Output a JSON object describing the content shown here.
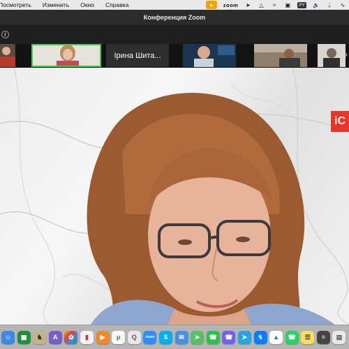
{
  "menubar": {
    "items": [
      "Посмотреть",
      "Изменить",
      "Окно",
      "Справка"
    ],
    "status": {
      "app_indicator": "zoom",
      "keyboard_layout": "PY"
    }
  },
  "window": {
    "title": "Конференция Zoom"
  },
  "participants": {
    "thumbnails": [
      {
        "type": "video",
        "description_icon": "participant-video"
      },
      {
        "type": "video",
        "active": true,
        "description_icon": "participant-video"
      },
      {
        "type": "name",
        "name": "Ірина Шита..."
      },
      {
        "type": "video",
        "description_icon": "participant-video"
      },
      {
        "type": "video",
        "description_icon": "participant-video"
      },
      {
        "type": "video",
        "description_icon": "participant-video"
      }
    ]
  },
  "main_video": {
    "brand_tag": "iC"
  },
  "colors": {
    "active_speaker_border": "#3ecb4e",
    "mic_indicator": "#f2a100",
    "brand_tag": "#e8342b"
  },
  "dock": {
    "icons": [
      "finder-icon",
      "spreadsheet-icon",
      "chess-icon",
      "translate-icon",
      "photos-icon",
      "books-icon",
      "taskmanager-icon",
      "torrent-icon",
      "quicktime-icon",
      "zoom-icon",
      "skype-icon",
      "mail-icon",
      "maps-icon",
      "facetime-icon",
      "viber-icon",
      "telegram-icon",
      "messenger-icon",
      "drive-icon",
      "whatsapp-icon",
      "notes-icon",
      "calculator-icon",
      "preview-icon"
    ]
  }
}
